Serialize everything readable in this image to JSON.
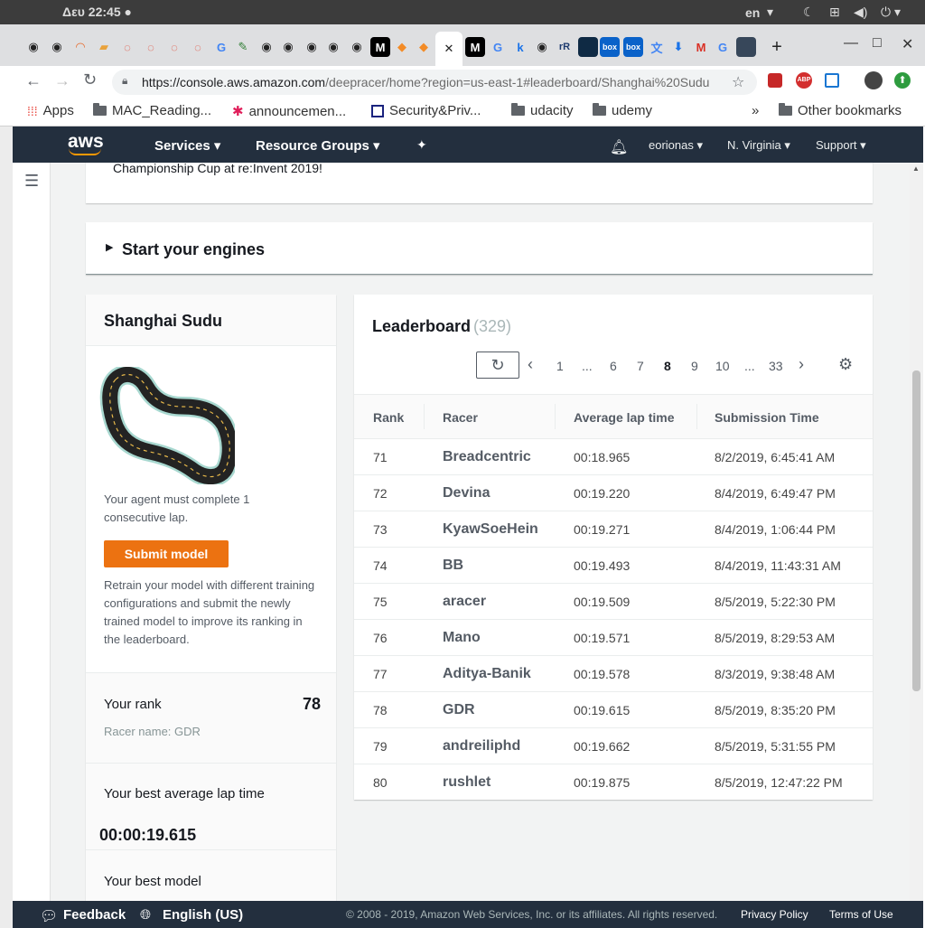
{
  "os": {
    "clock": "Δευ 22:45 ●",
    "lang": "en"
  },
  "browser": {
    "tab_icons": [
      "github-icon",
      "github-icon",
      "orange-icon",
      "colorful-icon",
      "spinner-icon",
      "spinner-icon",
      "spinner-icon",
      "spinner-icon",
      "google-icon",
      "colorful-icon",
      "github-icon",
      "github-icon",
      "github-icon",
      "github-icon",
      "github-icon",
      "medium-icon",
      "box-icon",
      "box-icon"
    ],
    "active_tab_close": "✕",
    "tab_letters": {
      "medium": "M",
      "google": "G",
      "k": "k",
      "rr": "rR",
      "box": "box"
    },
    "url_main": "https://console.aws.amazon.com",
    "url_rest": "/deepracer/home?region=us-east-1#leaderboard/Shanghai%20Sudu",
    "bookmarks": [
      "Apps",
      "MAC_Reading...",
      "announcemen...",
      "Security&Priv...",
      "udacity",
      "udemy"
    ],
    "bookmarks_more": "»",
    "other_bookmarks": "Other bookmarks"
  },
  "aws": {
    "logo": "aws",
    "services": "Services",
    "resource_groups": "Resource Groups",
    "user": "eorionas",
    "region": "N. Virginia",
    "support": "Support"
  },
  "content": {
    "top_card_text": "Championship Cup at re:Invent 2019!",
    "start_engines": "Start your engines",
    "track": {
      "name": "Shanghai Sudu",
      "requirement": "Your agent must complete 1 consecutive lap.",
      "submit": "Submit model",
      "retrain": "Retrain your model with different training configurations and submit the newly trained model to improve its ranking in the leaderboard.",
      "rank_label": "Your rank",
      "rank_value": "78",
      "racer_name": "Racer name: GDR",
      "best_lap_label": "Your best average lap time",
      "best_lap_value": "00:00:19.615",
      "best_model_label": "Your best model"
    },
    "leaderboard": {
      "title": "Leaderboard",
      "count": "(329)",
      "pages": [
        "1",
        "...",
        "6",
        "7",
        "8",
        "9",
        "10",
        "...",
        "33"
      ],
      "current_page": "8",
      "columns": [
        "Rank",
        "Racer",
        "Average lap time",
        "Submission Time"
      ],
      "rows": [
        [
          "71",
          "Breadcentric",
          "00:18.965",
          "8/2/2019, 6:45:41 AM"
        ],
        [
          "72",
          "Devina",
          "00:19.220",
          "8/4/2019, 6:49:47 PM"
        ],
        [
          "73",
          "KyawSoeHein",
          "00:19.271",
          "8/4/2019, 1:06:44 PM"
        ],
        [
          "74",
          "BB",
          "00:19.493",
          "8/4/2019, 11:43:31 AM"
        ],
        [
          "75",
          "aracer",
          "00:19.509",
          "8/5/2019, 5:22:30 PM"
        ],
        [
          "76",
          "Mano",
          "00:19.571",
          "8/5/2019, 8:29:53 AM"
        ],
        [
          "77",
          "Aditya-Banik",
          "00:19.578",
          "8/3/2019, 9:38:48 AM"
        ],
        [
          "78",
          "GDR",
          "00:19.615",
          "8/5/2019, 8:35:20 PM"
        ],
        [
          "79",
          "andreiliphd",
          "00:19.662",
          "8/5/2019, 5:31:55 PM"
        ],
        [
          "80",
          "rushlet",
          "00:19.875",
          "8/5/2019, 12:47:22 PM"
        ]
      ]
    }
  },
  "footer": {
    "feedback": "Feedback",
    "language": "English (US)",
    "copyright": "© 2008 - 2019, Amazon Web Services, Inc. or its affiliates. All rights reserved.",
    "privacy": "Privacy Policy",
    "terms": "Terms of Use"
  },
  "colors": {
    "aws_nav": "#232f3e",
    "orange": "#ec7211",
    "page_bg": "#f2f3f3"
  }
}
